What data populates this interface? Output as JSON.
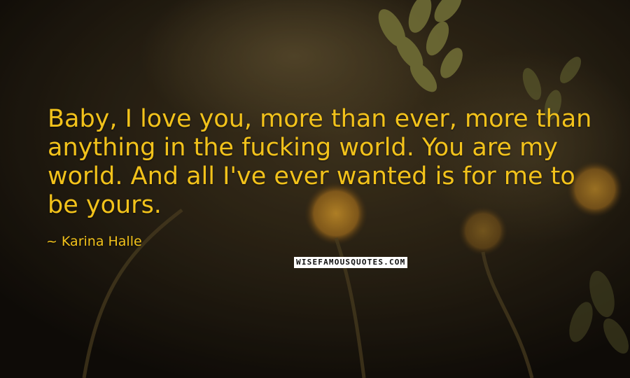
{
  "quote": {
    "text": "Baby, I love you, more than ever, more than anything in the fucking world. You are my world. And all I've ever wanted is for me to be yours.",
    "author_prefix": "~",
    "author": "Karina Halle",
    "color": "#f2c21b"
  },
  "watermark": {
    "text": "WISEFAMOUSQUOTES.COM"
  }
}
